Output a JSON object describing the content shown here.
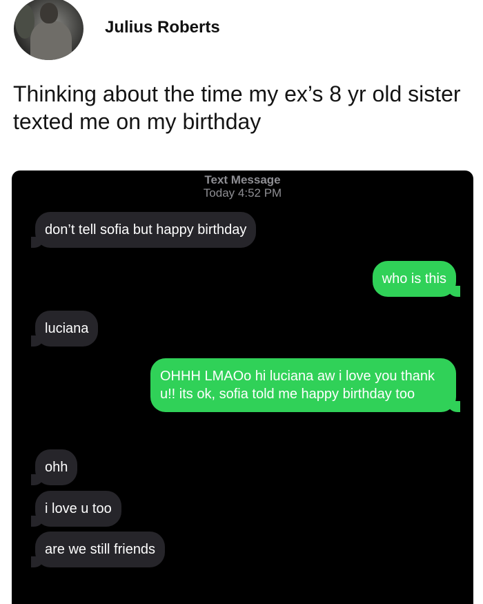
{
  "post": {
    "author": "Julius Roberts",
    "text": "Thinking about the time my ex’s 8 yr old sister texted me on my birthday"
  },
  "conversation": {
    "header_title": "Text Message",
    "header_day": "Today",
    "header_time": "4:52 PM",
    "messages": [
      {
        "from": "them",
        "text": "don’t tell sofia but happy birthday"
      },
      {
        "from": "me",
        "text": "who is this"
      },
      {
        "from": "them",
        "text": "luciana"
      },
      {
        "from": "me",
        "text": "OHHH LMAOo hi luciana aw i love you thank u!! its ok, sofia told me happy birthday too"
      },
      {
        "from": "them",
        "text": "ohh"
      },
      {
        "from": "them",
        "text": "i love u too"
      },
      {
        "from": "them",
        "text": "are we still friends"
      }
    ]
  },
  "colors": {
    "incoming_bubble": "#26252a",
    "outgoing_bubble": "#30d158",
    "background": "#000000"
  }
}
